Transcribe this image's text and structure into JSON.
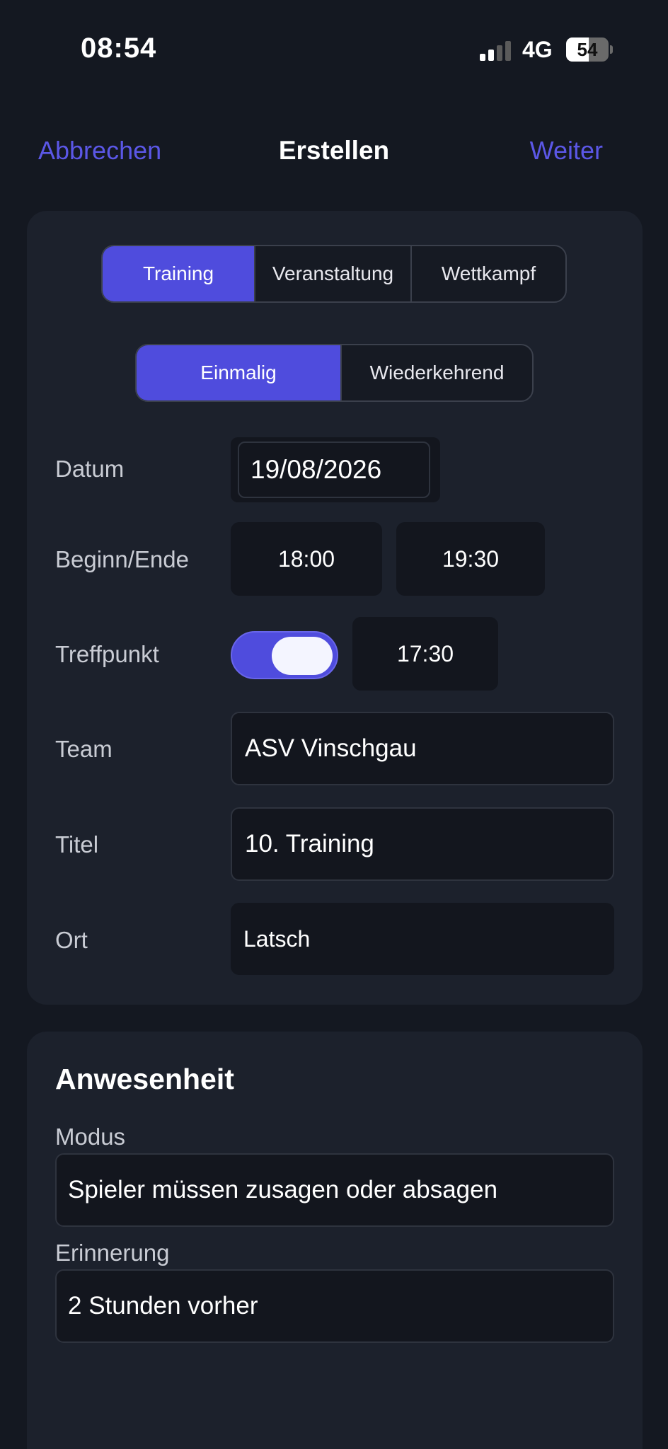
{
  "status_bar": {
    "time": "08:54",
    "network": "4G",
    "battery_percent": "54",
    "signal_icon": "signal-bars-icon",
    "battery_icon": "battery-icon"
  },
  "nav": {
    "cancel_label": "Abbrechen",
    "title": "Erstellen",
    "next_label": "Weiter"
  },
  "accent_color": "#4f4cdd",
  "event_type": {
    "options": [
      "Training",
      "Veranstaltung",
      "Wettkampf"
    ],
    "selected": "Training"
  },
  "frequency": {
    "options": [
      "Einmalig",
      "Wiederkehrend"
    ],
    "selected": "Einmalig"
  },
  "form": {
    "date_label": "Datum",
    "date_value": "19/08/2026",
    "time_label": "Beginn/Ende",
    "start_time": "18:00",
    "end_time": "19:30",
    "meeting_label": "Treffpunkt",
    "meeting_enabled": true,
    "meeting_time": "17:30",
    "team_label": "Team",
    "team_value": "ASV Vinschgau",
    "title_label": "Titel",
    "title_value": "10. Training",
    "location_label": "Ort",
    "location_value": "Latsch"
  },
  "attendance": {
    "section_title": "Anwesenheit",
    "mode_label": "Modus",
    "mode_value": "Spieler müssen zusagen oder absagen",
    "reminder_label": "Erinnerung",
    "reminder_value": "2 Stunden vorher"
  }
}
